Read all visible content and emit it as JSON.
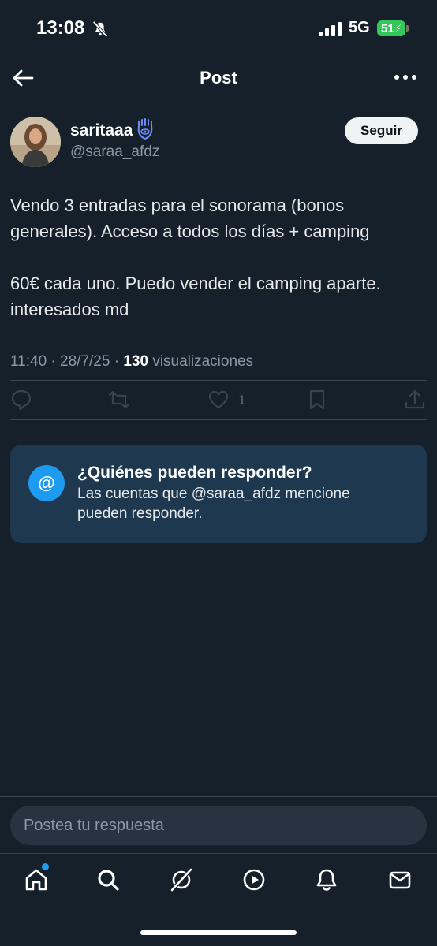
{
  "status_bar": {
    "time": "13:08",
    "network": "5G",
    "battery": "51"
  },
  "header": {
    "title": "Post"
  },
  "author": {
    "display_name": "saritaaa",
    "handle": "@saraa_afdz",
    "follow_label": "Seguir"
  },
  "tweet": {
    "text": "Vendo 3 entradas para el sonorama (bonos generales). Acceso a todos los días + camping\n\n60€ cada uno. Puedo vender el camping aparte. interesados md",
    "time": "11:40",
    "date": "28/7/25",
    "views_count": "130",
    "views_label": "visualizaciones",
    "like_count": "1"
  },
  "reply_restriction": {
    "icon_text": "@",
    "title": "¿Quiénes pueden responder?",
    "description": "Las cuentas que @saraa_afdz mencione pueden responder."
  },
  "compose": {
    "placeholder": "Postea tu respuesta"
  },
  "colors": {
    "background": "#15202b",
    "accent": "#1d9bf0",
    "card": "#1e3850",
    "muted": "#8b98a5"
  }
}
